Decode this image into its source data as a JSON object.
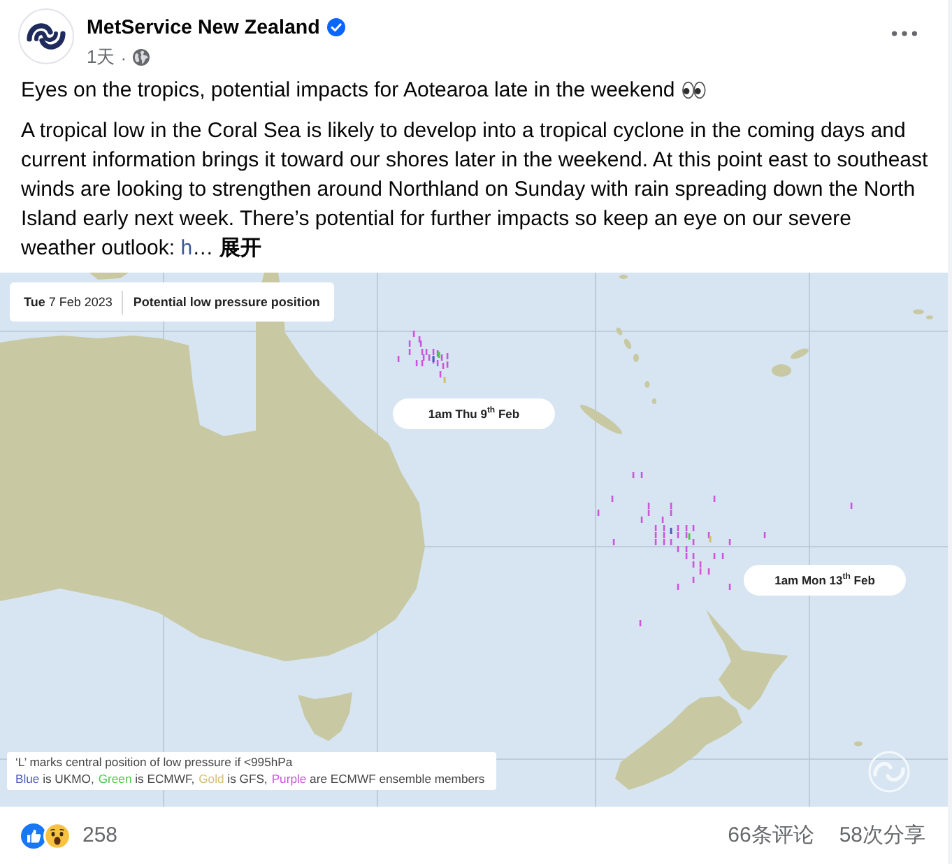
{
  "post": {
    "author": "MetService New Zealand",
    "verified": true,
    "time": "1天",
    "separator": "·"
  },
  "text": {
    "headline": "Eyes on the tropics, potential impacts for Aotearoa late in the weekend",
    "body": "A tropical low in the Coral Sea is likely to develop into a tropical cyclone in the coming days and current information brings it toward our shores later in the weekend. At this point east to southeast winds are looking to strengthen around Northland on Sunday with rain spreading down the North Island early next week. There’s potential for further impacts so keep an eye on our severe weather outlook:",
    "link": "h",
    "ellipsis": "…",
    "see_more": "展开"
  },
  "map": {
    "date": "**Tue** 7 Feb 2023",
    "title": "Potential low pressure position",
    "time_labels": [
      "1am Thu 9$^{th}$ Feb",
      "1am Mon 13$^{th}$ Feb"
    ],
    "legend": {
      "note": "‘L’ marks central position of low pressure if <995hPa",
      "models": [
        {
          "color_name": "Blue",
          "color": "#4c5cbf",
          "source": "is UKMO,"
        },
        {
          "color_name": "Green",
          "color": "#4fc94f",
          "source": "is ECMWF,"
        },
        {
          "color_name": "Gold",
          "color": "#d6bd72",
          "source": "is GFS,"
        },
        {
          "color_name": "Purple",
          "color": "#cc55dd",
          "source": "are ECMWF ensemble members"
        }
      ]
    }
  },
  "footer": {
    "reaction_count": "258",
    "comments": "66条评论",
    "shares": "58次分享"
  }
}
